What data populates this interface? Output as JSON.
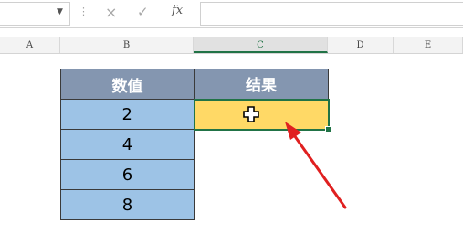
{
  "formula_bar": {
    "name_box_value": "",
    "formula_value": "",
    "cancel_glyph": "×",
    "enter_glyph": "✓",
    "fx_label": "fx"
  },
  "column_headers": [
    "A",
    "B",
    "C",
    "D",
    "E"
  ],
  "selected_column": "C",
  "table": {
    "header_value": "数值",
    "header_result": "结果",
    "values": [
      "2",
      "4",
      "6",
      "8"
    ],
    "result_cell_value": ""
  },
  "colors": {
    "header_fill": "#8496b0",
    "value_fill": "#9dc3e6",
    "result_fill": "#ffd966",
    "selection_border": "#217346",
    "arrow": "#e02020"
  },
  "icons": [
    "dropdown-arrow-icon",
    "cancel-icon",
    "enter-icon",
    "fx-icon",
    "cell-cursor-icon",
    "annotation-arrow-icon"
  ]
}
